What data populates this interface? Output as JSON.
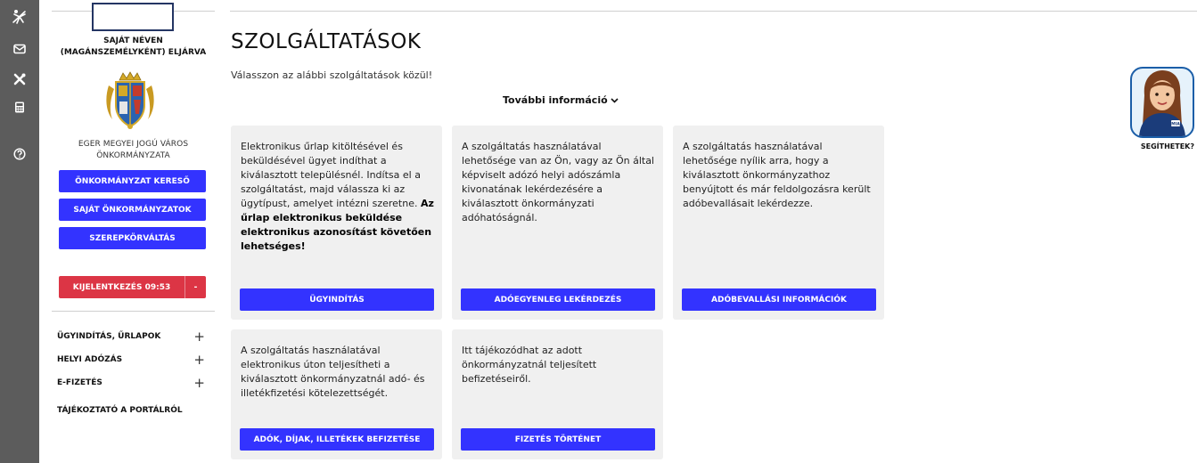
{
  "rail": {
    "icons": [
      "accessibility-icon",
      "mail-icon",
      "tools-icon",
      "calculator-icon",
      "help-circle-icon"
    ]
  },
  "sidebar": {
    "mode_text": "SAJÁT NÉVEN (MAGÁNSZEMÉLYKÉNT) ELJÁRVA",
    "municipality": "EGER MEGYEI JOGÚ VÁROS ÖNKORMÁNYZATA",
    "buttons": [
      "ÖNKORMÁNYZAT KERESŐ",
      "SAJÁT ÖNKORMÁNYZATOK",
      "SZEREPKÖRVÁLTÁS"
    ],
    "logout_label": "KIJELENTKEZÉS 09:53",
    "logout_dropdown": "-",
    "menu": [
      {
        "label": "ÜGYINDÍTÁS, ŰRLAPOK",
        "expander": "+"
      },
      {
        "label": "HELYI ADÓZÁS",
        "expander": "+"
      },
      {
        "label": "E-FIZETÉS",
        "expander": "+"
      },
      {
        "label": "TÁJÉKOZTATÓ A PORTÁLRÓL",
        "expander": ""
      }
    ]
  },
  "main": {
    "title": "SZOLGÁLTATÁSOK",
    "subtitle": "Válasszon az alábbi szolgáltatások közül!",
    "more_info": "További információ",
    "cards": [
      {
        "text": "Elektronikus űrlap kitöltésével és beküldésével ügyet indíthat a kiválasztott településnél. Indítsa el a szolgáltatást, majd válassza ki az ügytípust, amelyet intézni szeretne.",
        "bold": "Az űrlap elektronikus beküldése elektronikus azonosítást követően lehetséges!",
        "button": "ÜGYINDÍTÁS"
      },
      {
        "text": "A szolgáltatás használatával lehetősége van az Ön, vagy az Ön által képviselt adózó helyi adószámla kivonatának lekérdezésére a kiválasztott önkormányzati adóhatóságnál.",
        "bold": "",
        "button": "ADÓEGYENLEG LEKÉRDEZÉS"
      },
      {
        "text": "A szolgáltatás használatával lehetősége nyílik arra, hogy a kiválasztott önkormányzathoz benyújtott és már feldolgozásra került adóbevallásait lekérdezze.",
        "bold": "",
        "button": "ADÓBEVALLÁSI INFORMÁCIÓK"
      },
      {
        "text": "A szolgáltatás használatával elektronikus úton teljesítheti a kiválasztott önkormányzatnál adó- és illetékfizetési kötelezettségét.",
        "bold": "",
        "button": "ADÓK, DÍJAK, ILLETÉKEK BEFIZETÉSE"
      },
      {
        "text": "Itt tájékozódhat az adott önkormányzatnál teljesített befizetéseiről.",
        "bold": "",
        "button": "FIZETÉS TÖRTÉNET"
      }
    ]
  },
  "helper": {
    "label": "SEGÍTHETEK?",
    "badge": "MIA"
  },
  "colors": {
    "primary": "#3333ff",
    "logout": "#dc3545",
    "rail": "#5c5c5c",
    "card_bg": "#f0f0f0"
  }
}
